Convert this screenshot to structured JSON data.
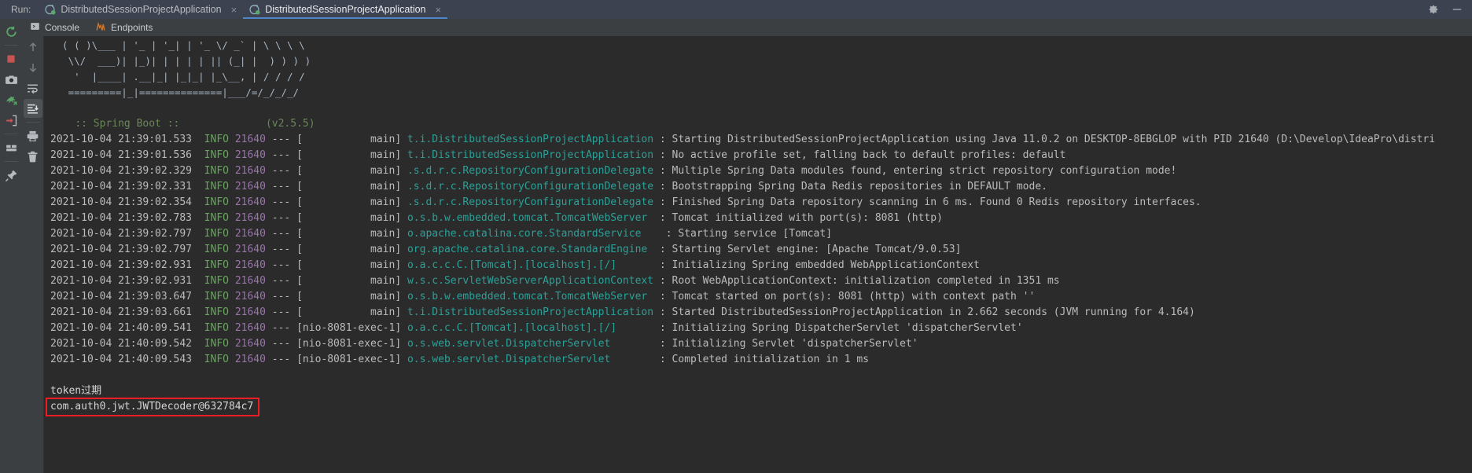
{
  "window": {
    "run_label": "Run:",
    "tabs": [
      {
        "label": "DistributedSessionProjectApplication",
        "icon": "spring-boot-icon",
        "close": "×",
        "active": false
      },
      {
        "label": "DistributedSessionProjectApplication",
        "icon": "spring-boot-icon",
        "close": "×",
        "active": true
      }
    ],
    "right_icons": [
      {
        "name": "gear-icon",
        "glyph": "⚙"
      },
      {
        "name": "hide-icon",
        "glyph": "—"
      }
    ]
  },
  "subtabs": [
    {
      "label": "Console",
      "icon": "console-icon"
    },
    {
      "label": "Endpoints",
      "icon": "endpoints-icon"
    }
  ],
  "gutter_left": [
    {
      "name": "rerun-button",
      "icon": "rerun-icon",
      "color": "#59a869"
    },
    {
      "name": "stop-button",
      "icon": "stop-square-icon",
      "color": "#c75450"
    },
    {
      "name": "screenshot-button",
      "icon": "camera-icon",
      "color": "#a9adb3"
    },
    {
      "name": "export-thread-dump-button",
      "icon": "green-dragon-icon",
      "color": "#59a869"
    },
    {
      "name": "attach-console-button",
      "icon": "red-arrow-box-icon",
      "color": "#c75450"
    },
    {
      "name": "layout-settings-button",
      "icon": "layout-icon",
      "color": "#a9adb3"
    },
    {
      "name": "pin-tab-button",
      "icon": "pin-icon",
      "color": "#a9adb3"
    }
  ],
  "gutter_right": [
    {
      "name": "scroll-up-button",
      "icon": "arrow-up-icon",
      "selected": false
    },
    {
      "name": "scroll-down-button",
      "icon": "arrow-down-icon",
      "selected": false
    },
    {
      "name": "soft-wrap-button",
      "icon": "soft-wrap-icon",
      "selected": false
    },
    {
      "name": "scroll-to-end-button",
      "icon": "scroll-to-end-icon",
      "selected": true
    },
    {
      "name": "print-button",
      "icon": "printer-icon",
      "selected": false
    },
    {
      "name": "clear-all-button",
      "icon": "trash-icon",
      "selected": false
    }
  ],
  "banner": {
    "lines": [
      "  ( ( )\\___ | '_ | '_| | '_ \\/ _` | \\ \\ \\ \\",
      "   \\\\/  ___)| |_)| | | | | || (_| |  ) ) ) )",
      "    '  |____| .__|_| |_|_| |_\\__, | / / / /",
      "   =========|_|==============|___/=/_/_/_/"
    ],
    "version_label": ":: Spring Boot ::",
    "version_value": "(v2.5.5)"
  },
  "log_columns": {
    "level": "INFO",
    "pid": "21640",
    "dash": "---"
  },
  "log_lines": [
    {
      "ts": "2021-10-04 21:39:01.533",
      "level": "INFO",
      "pid": "21640",
      "thread": "[           main]",
      "logger": "t.i.DistributedSessionProjectApplication",
      "msg": ": Starting DistributedSessionProjectApplication using Java 11.0.2 on DESKTOP-8EBGLOP with PID 21640 (D:\\Develop\\IdeaPro\\distri"
    },
    {
      "ts": "2021-10-04 21:39:01.536",
      "level": "INFO",
      "pid": "21640",
      "thread": "[           main]",
      "logger": "t.i.DistributedSessionProjectApplication",
      "msg": ": No active profile set, falling back to default profiles: default"
    },
    {
      "ts": "2021-10-04 21:39:02.329",
      "level": "INFO",
      "pid": "21640",
      "thread": "[           main]",
      "logger": ".s.d.r.c.RepositoryConfigurationDelegate",
      "msg": ": Multiple Spring Data modules found, entering strict repository configuration mode!"
    },
    {
      "ts": "2021-10-04 21:39:02.331",
      "level": "INFO",
      "pid": "21640",
      "thread": "[           main]",
      "logger": ".s.d.r.c.RepositoryConfigurationDelegate",
      "msg": ": Bootstrapping Spring Data Redis repositories in DEFAULT mode."
    },
    {
      "ts": "2021-10-04 21:39:02.354",
      "level": "INFO",
      "pid": "21640",
      "thread": "[           main]",
      "logger": ".s.d.r.c.RepositoryConfigurationDelegate",
      "msg": ": Finished Spring Data repository scanning in 6 ms. Found 0 Redis repository interfaces."
    },
    {
      "ts": "2021-10-04 21:39:02.783",
      "level": "INFO",
      "pid": "21640",
      "thread": "[           main]",
      "logger": "o.s.b.w.embedded.tomcat.TomcatWebServer ",
      "msg": ": Tomcat initialized with port(s): 8081 (http)"
    },
    {
      "ts": "2021-10-04 21:39:02.797",
      "level": "INFO",
      "pid": "21640",
      "thread": "[           main]",
      "logger": "o.apache.catalina.core.StandardService   ",
      "msg": ": Starting service [Tomcat]"
    },
    {
      "ts": "2021-10-04 21:39:02.797",
      "level": "INFO",
      "pid": "21640",
      "thread": "[           main]",
      "logger": "org.apache.catalina.core.StandardEngine ",
      "msg": ": Starting Servlet engine: [Apache Tomcat/9.0.53]"
    },
    {
      "ts": "2021-10-04 21:39:02.931",
      "level": "INFO",
      "pid": "21640",
      "thread": "[           main]",
      "logger": "o.a.c.c.C.[Tomcat].[localhost].[/]      ",
      "msg": ": Initializing Spring embedded WebApplicationContext"
    },
    {
      "ts": "2021-10-04 21:39:02.931",
      "level": "INFO",
      "pid": "21640",
      "thread": "[           main]",
      "logger": "w.s.c.ServletWebServerApplicationContext",
      "msg": ": Root WebApplicationContext: initialization completed in 1351 ms"
    },
    {
      "ts": "2021-10-04 21:39:03.647",
      "level": "INFO",
      "pid": "21640",
      "thread": "[           main]",
      "logger": "o.s.b.w.embedded.tomcat.TomcatWebServer ",
      "msg": ": Tomcat started on port(s): 8081 (http) with context path ''"
    },
    {
      "ts": "2021-10-04 21:39:03.661",
      "level": "INFO",
      "pid": "21640",
      "thread": "[           main]",
      "logger": "t.i.DistributedSessionProjectApplication",
      "msg": ": Started DistributedSessionProjectApplication in 2.662 seconds (JVM running for 4.164)"
    },
    {
      "ts": "2021-10-04 21:40:09.541",
      "level": "INFO",
      "pid": "21640",
      "thread": "[nio-8081-exec-1]",
      "logger": "o.a.c.c.C.[Tomcat].[localhost].[/]      ",
      "msg": ": Initializing Spring DispatcherServlet 'dispatcherServlet'"
    },
    {
      "ts": "2021-10-04 21:40:09.542",
      "level": "INFO",
      "pid": "21640",
      "thread": "[nio-8081-exec-1]",
      "logger": "o.s.web.servlet.DispatcherServlet       ",
      "msg": ": Initializing Servlet 'dispatcherServlet'"
    },
    {
      "ts": "2021-10-04 21:40:09.543",
      "level": "INFO",
      "pid": "21640",
      "thread": "[nio-8081-exec-1]",
      "logger": "o.s.web.servlet.DispatcherServlet       ",
      "msg": ": Completed initialization in 1 ms"
    }
  ],
  "stdout_lines": [
    {
      "text": "token过期",
      "highlighted": false
    },
    {
      "text": "com.auth0.jwt.JWTDecoder@632784c7",
      "highlighted": true
    }
  ],
  "annotation": {
    "color": "#ee1c25",
    "target": "com.auth0.jwt.JWTDecoder@632784c7"
  }
}
